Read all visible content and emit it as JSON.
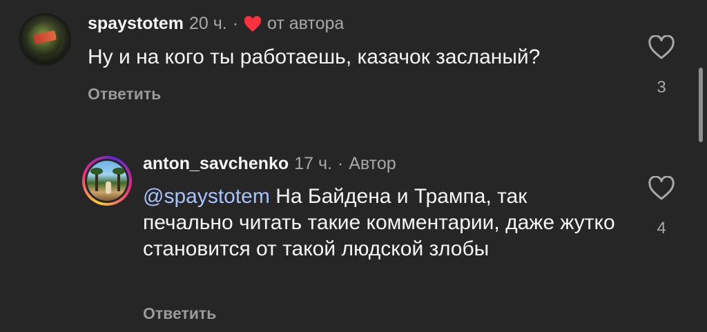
{
  "comments": [
    {
      "username": "spaystotem",
      "time": "20 ч.",
      "separator": "·",
      "badge": "от автора",
      "badge_icon": "heart-filled-icon",
      "text": "Ну и на кого ты работаешь, казачок засланый?",
      "reply_label": "Ответить",
      "likes": "3"
    },
    {
      "username": "anton_savchenko",
      "time": "17 ч.",
      "separator": "·",
      "badge": "Автор",
      "mention": "@spaystotem",
      "text": " На Байдена и Трампа, так печально читать такие комментарии, даже жутко становится от такой людской злобы",
      "reply_label": "Ответить",
      "likes": "4"
    }
  ],
  "colors": {
    "background": "#262626",
    "mention": "#a7c4ff",
    "heart": "#ff3040"
  }
}
